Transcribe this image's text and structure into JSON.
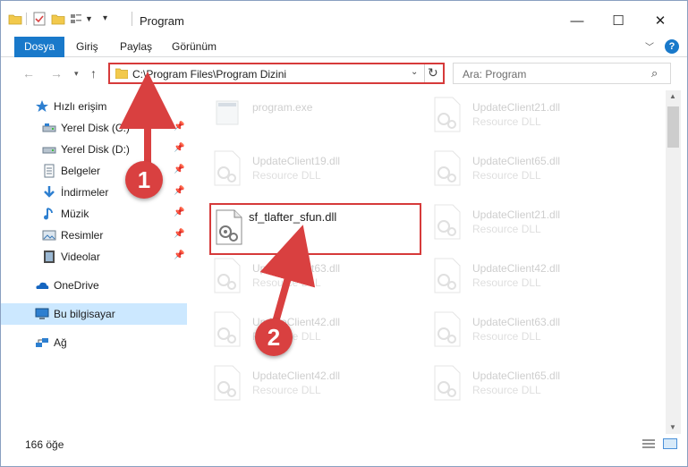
{
  "window": {
    "title": "Program",
    "controls": {
      "minimize": "—",
      "maximize": "☐",
      "close": "✕"
    }
  },
  "ribbon": {
    "tabs": [
      {
        "label": "Dosya"
      },
      {
        "label": "Giriş"
      },
      {
        "label": "Paylaş"
      },
      {
        "label": "Görünüm"
      }
    ],
    "help": "?"
  },
  "navbar": {
    "address": "C:\\Program Files\\Program Dizini",
    "search_placeholder": "Ara: Program"
  },
  "sidebar": {
    "items": [
      {
        "label": "Hızlı erişim",
        "icon": "star-icon"
      },
      {
        "label": "Yerel Disk (C:)",
        "icon": "drive-icon",
        "pinned": true
      },
      {
        "label": "Yerel Disk (D:)",
        "icon": "drive-icon",
        "pinned": true
      },
      {
        "label": "Belgeler",
        "icon": "documents-icon",
        "pinned": true
      },
      {
        "label": "İndirmeler",
        "icon": "download-icon",
        "pinned": true
      },
      {
        "label": "Müzik",
        "icon": "music-icon",
        "pinned": true
      },
      {
        "label": "Resimler",
        "icon": "pictures-icon",
        "pinned": true
      },
      {
        "label": "Videolar",
        "icon": "videos-icon",
        "pinned": true
      },
      {
        "label": "OneDrive",
        "icon": "onedrive-icon"
      },
      {
        "label": "Bu bilgisayar",
        "icon": "computer-icon",
        "selected": true
      },
      {
        "label": "Ağ",
        "icon": "network-icon"
      }
    ]
  },
  "files": {
    "left": [
      {
        "name": "program.exe",
        "type": ""
      },
      {
        "name": "UpdateClient19.dll",
        "type": "Resource DLL"
      },
      {
        "name": "sf_tlafter_sfun.dll",
        "type": ""
      },
      {
        "name": "UpdateClient63.dll",
        "type": "Resource DLL"
      },
      {
        "name": "UpdateClient42.dll",
        "type": "Resource DLL"
      },
      {
        "name": "UpdateClient42.dll",
        "type": "Resource DLL"
      }
    ],
    "right": [
      {
        "name": "UpdateClient21.dll",
        "type": "Resource DLL"
      },
      {
        "name": "UpdateClient65.dll",
        "type": "Resource DLL"
      },
      {
        "name": "UpdateClient21.dll",
        "type": "Resource DLL"
      },
      {
        "name": "UpdateClient42.dll",
        "type": "Resource DLL"
      },
      {
        "name": "UpdateClient63.dll",
        "type": "Resource DLL"
      },
      {
        "name": "UpdateClient65.dll",
        "type": "Resource DLL"
      }
    ]
  },
  "status": {
    "count": "166 öğe"
  },
  "callouts": {
    "one": "1",
    "two": "2"
  },
  "colors": {
    "accent": "#1979ca",
    "highlight": "#d63a3a",
    "selected": "#cce8ff"
  }
}
